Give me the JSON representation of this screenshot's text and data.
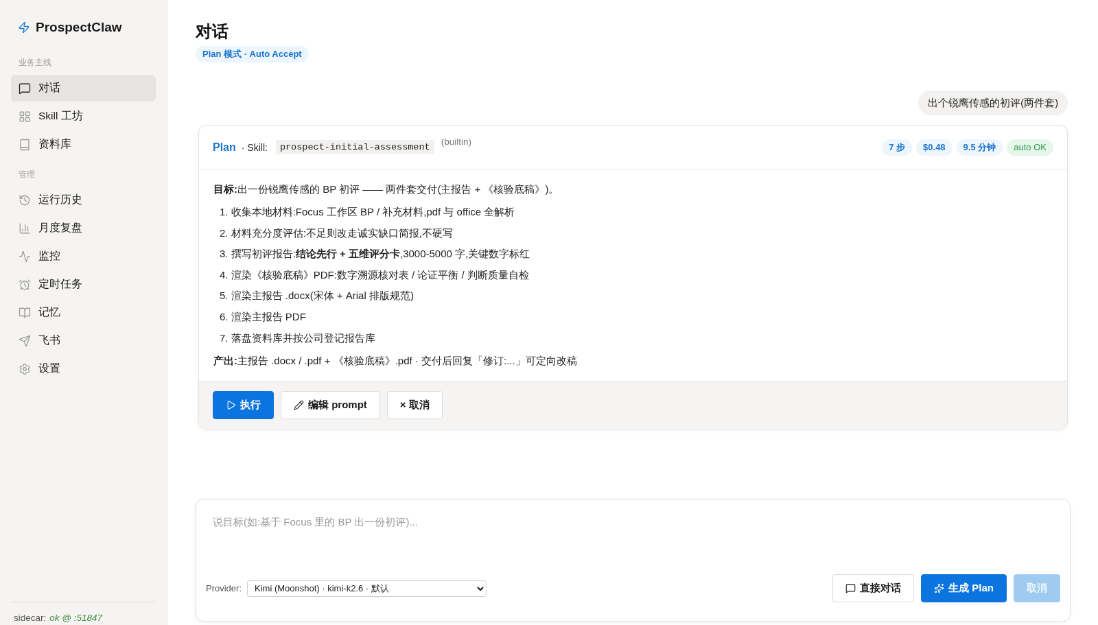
{
  "sidebar": {
    "brand": "ProspectClaw",
    "sections": [
      {
        "label": "业务主线",
        "items": [
          {
            "label": "对话",
            "selected": true
          },
          {
            "label": "Skill 工坊",
            "selected": false
          },
          {
            "label": "资料库",
            "selected": false
          }
        ]
      },
      {
        "label": "管理",
        "items": [
          {
            "label": "运行历史",
            "selected": false
          },
          {
            "label": "月度复盘",
            "selected": false
          },
          {
            "label": "监控",
            "selected": false
          },
          {
            "label": "定时任务",
            "selected": false
          },
          {
            "label": "记忆",
            "selected": false
          },
          {
            "label": "飞书",
            "selected": false
          },
          {
            "label": "设置",
            "selected": false
          }
        ]
      }
    ],
    "status": {
      "label": "sidecar:",
      "value": "ok @ :51847"
    }
  },
  "header": {
    "title": "对话",
    "mode": "Plan 模式 · Auto Accept"
  },
  "messages": [
    {
      "kind": "user",
      "text": "出个锐鹰传感的初评(两件套)"
    }
  ],
  "plan": {
    "title": "Plan",
    "skill_label": "· Skill:",
    "skill": "prospect-initial-assessment",
    "skill_source": "(builtin)",
    "stats": [
      {
        "kind": "info",
        "text": "7 步"
      },
      {
        "kind": "info",
        "text": "$0.48"
      },
      {
        "kind": "info",
        "text": "9.5 分钟"
      },
      {
        "kind": "success",
        "text": "auto OK"
      }
    ],
    "goal": "**目标:**出一份锐鹰传感的 BP 初评 —— 两件套交付(主报告 + 《核验底稿》)。",
    "steps": [
      "1. 收集本地材料:Focus 工作区 BP / 补充材料,pdf 与 office 全解析",
      "2. 材料充分度评估:不足则改走诚实缺口简报,不硬写",
      "3. 撰写初评报告:**结论先行 + 五维评分卡**,3000-5000 字,关键数字标红",
      "4. 渲染《核验底稿》PDF:数字溯源核对表 / 论证平衡 / 判断质量自检",
      "5. 渲染主报告 .docx(宋体 + Arial 排版规范)",
      "6. 渲染主报告 PDF",
      "7. 落盘资料库并按公司登记报告库"
    ],
    "output": "**产出:**主报告 .docx / .pdf + 《核验底稿》.pdf · 交付后回复「修订:...」可定向改稿",
    "actions": [
      {
        "kind": "primary",
        "label": "执行"
      },
      {
        "kind": "secondary",
        "label": "编辑 prompt"
      },
      {
        "kind": "secondary",
        "label": "× 取消"
      }
    ]
  },
  "composer": {
    "placeholder": "说目标(如:基于 Focus 里的 BP 出一份初评)...",
    "provider_label": "Provider:",
    "provider": "Kimi (Moonshot) · kimi-k2.6 · 默认",
    "actions": [
      {
        "kind": "secondary",
        "label": "直接对话",
        "disabled": false
      },
      {
        "kind": "primary",
        "label": "生成 Plan",
        "disabled": false
      },
      {
        "kind": "primary",
        "label": "取消",
        "disabled": true
      }
    ]
  }
}
